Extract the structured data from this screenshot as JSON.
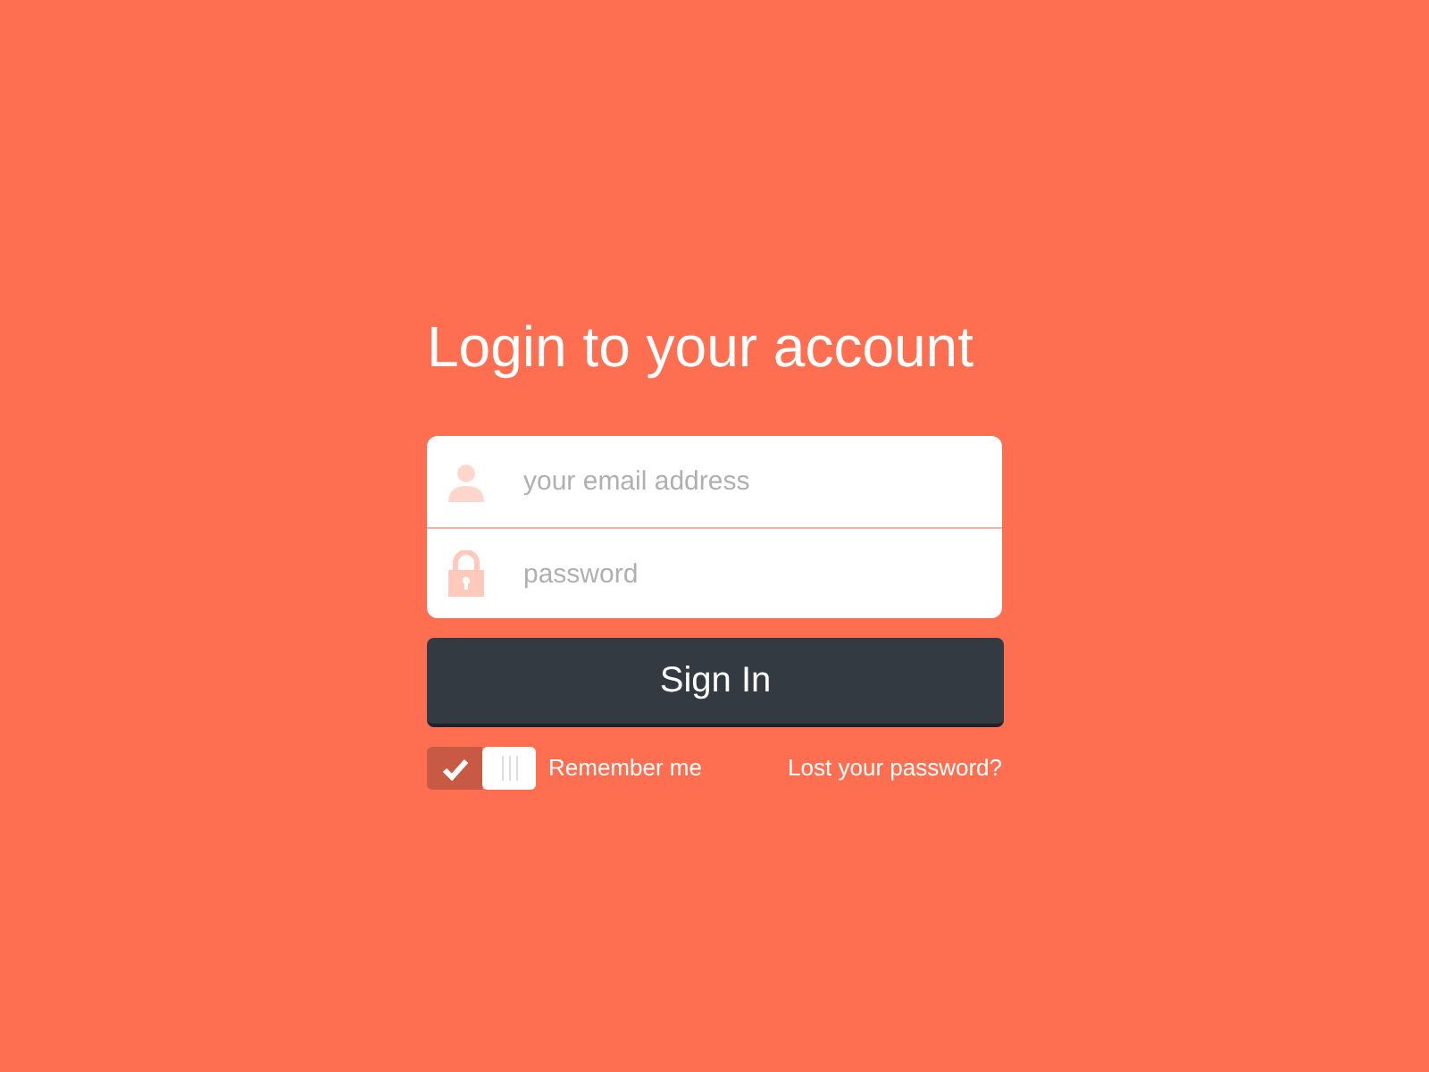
{
  "title": "Login to your account",
  "fields": [
    {
      "kind": "email",
      "placeholder": "your email address"
    },
    {
      "kind": "password",
      "placeholder": "password"
    }
  ],
  "submit": "Sign In",
  "remember": {
    "label": "Remember me",
    "on": true
  },
  "forgot_link": "Lost your password?"
}
